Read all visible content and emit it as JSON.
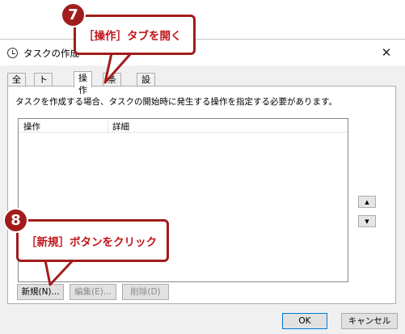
{
  "window": {
    "title": "タスクの作成",
    "close_glyph": "✕"
  },
  "tabs": [
    {
      "label": "全般"
    },
    {
      "label": "トリガー"
    },
    {
      "label": "操作"
    },
    {
      "label": "条件"
    },
    {
      "label": "設定"
    }
  ],
  "panel": {
    "description": "タスクを作成する場合、タスクの開始時に発生する操作を指定する必要があります。",
    "columns": [
      "操作",
      "詳細"
    ],
    "move_up_glyph": "▲",
    "move_down_glyph": "▼"
  },
  "buttons": {
    "new": "新規(N)...",
    "edit": "編集(E)...",
    "delete": "削除(D)",
    "ok": "OK",
    "cancel": "キャンセル"
  },
  "annotations": {
    "step7": {
      "number": "7",
      "text": "［操作］タブを開く"
    },
    "step8": {
      "number": "8",
      "text": "［新規］ボタンをクリック"
    },
    "color": "#a11d1d"
  }
}
